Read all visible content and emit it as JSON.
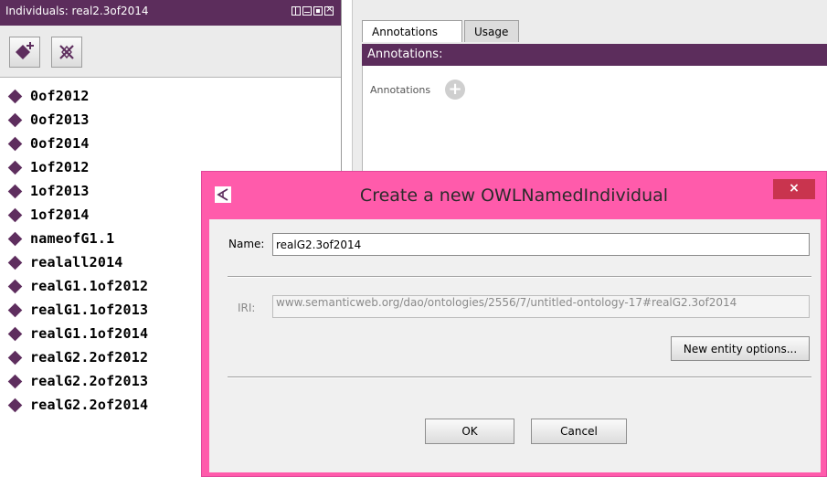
{
  "left_panel": {
    "title": "Individuals: real2.3of2014",
    "individuals": [
      "0of2012",
      "0of2013",
      "0of2014",
      "1of2012",
      "1of2013",
      "1of2014",
      "nameofG1.1",
      "realall2014",
      "realG1.1of2012",
      "realG1.1of2013",
      "realG1.1of2014",
      "realG2.2of2012",
      "realG2.2of2013",
      "realG2.2of2014"
    ],
    "toolbar_icons": [
      "add-individual-icon",
      "delete-individual-icon"
    ]
  },
  "right_panel": {
    "tabs": [
      {
        "label": "Annotations",
        "selected": true
      },
      {
        "label": "Usage",
        "selected": false
      }
    ],
    "header": "Annotations:",
    "annotations_label": "Annotations"
  },
  "dialog": {
    "title": "Create a new OWLNamedIndividual",
    "close_glyph": "×",
    "name_label": "Name:",
    "name_value": "realG2.3of2014",
    "iri_label": "IRI:",
    "iri_value": "www.semanticweb.org/dao/ontologies/2556/7/untitled-ontology-17#realG2.3of2014",
    "new_entity_options_label": "New entity options...",
    "ok_label": "OK",
    "cancel_label": "Cancel"
  },
  "colors": {
    "accent_purple": "#5c2d5c",
    "dialog_frame": "#ff5bab",
    "close_button": "#c9344e"
  }
}
